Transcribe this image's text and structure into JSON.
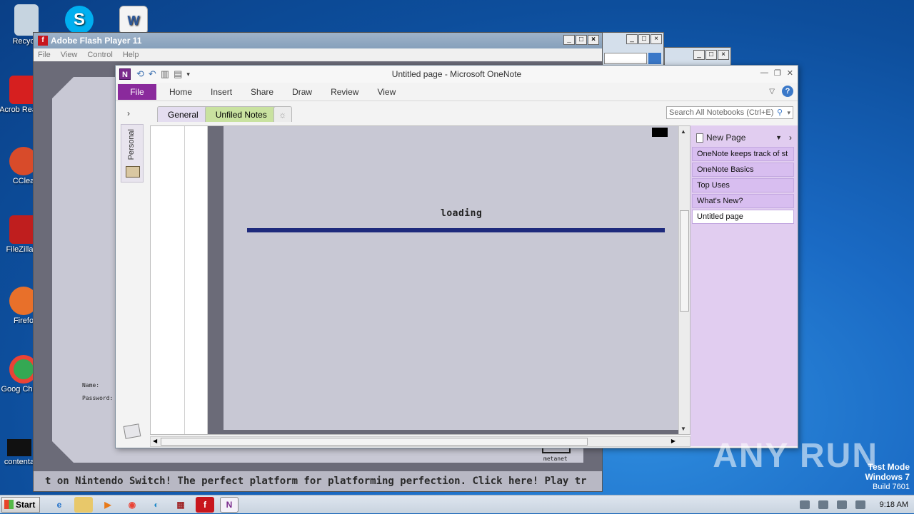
{
  "desktop": {
    "icons": [
      {
        "label": "Recycle"
      },
      {
        "label": ""
      },
      {
        "label": ""
      },
      {
        "label": "Acrob Reader"
      },
      {
        "label": "CClea"
      },
      {
        "label": "FileZilla C"
      },
      {
        "label": "Firefo"
      },
      {
        "label": "Goog Chrom"
      },
      {
        "label": "contenta"
      }
    ]
  },
  "flash": {
    "title": "Adobe Flash Player 11",
    "menu": [
      "File",
      "View",
      "Control",
      "Help"
    ],
    "name_label": "Name:",
    "password_label": "Password:",
    "ticker": "t on Nintendo Switch! The perfect platform for platforming perfection. Click here!        Play tr",
    "metanet": "metanet"
  },
  "onenote": {
    "title": "Untitled page  -  Microsoft OneNote",
    "file_tab": "File",
    "ribbon_tabs": [
      "Home",
      "Insert",
      "Share",
      "Draw",
      "Review",
      "View"
    ],
    "notebook": "Personal",
    "section_tabs": [
      "General",
      "Unfiled Notes"
    ],
    "search_placeholder": "Search All Notebooks (Ctrl+E)",
    "new_page": "New Page",
    "pages": [
      "OneNote keeps track of st",
      "OneNote Basics",
      "Top Uses",
      "What's New?",
      "Untitled page"
    ],
    "selected_page": 4,
    "loading_text": "loading"
  },
  "taskbar": {
    "start": "Start",
    "clock": "9:18 AM"
  },
  "watermark": "ANY RUN",
  "wininfo": {
    "line1": "Test Mode",
    "line2": "Windows 7",
    "line3": "Build 7601"
  }
}
